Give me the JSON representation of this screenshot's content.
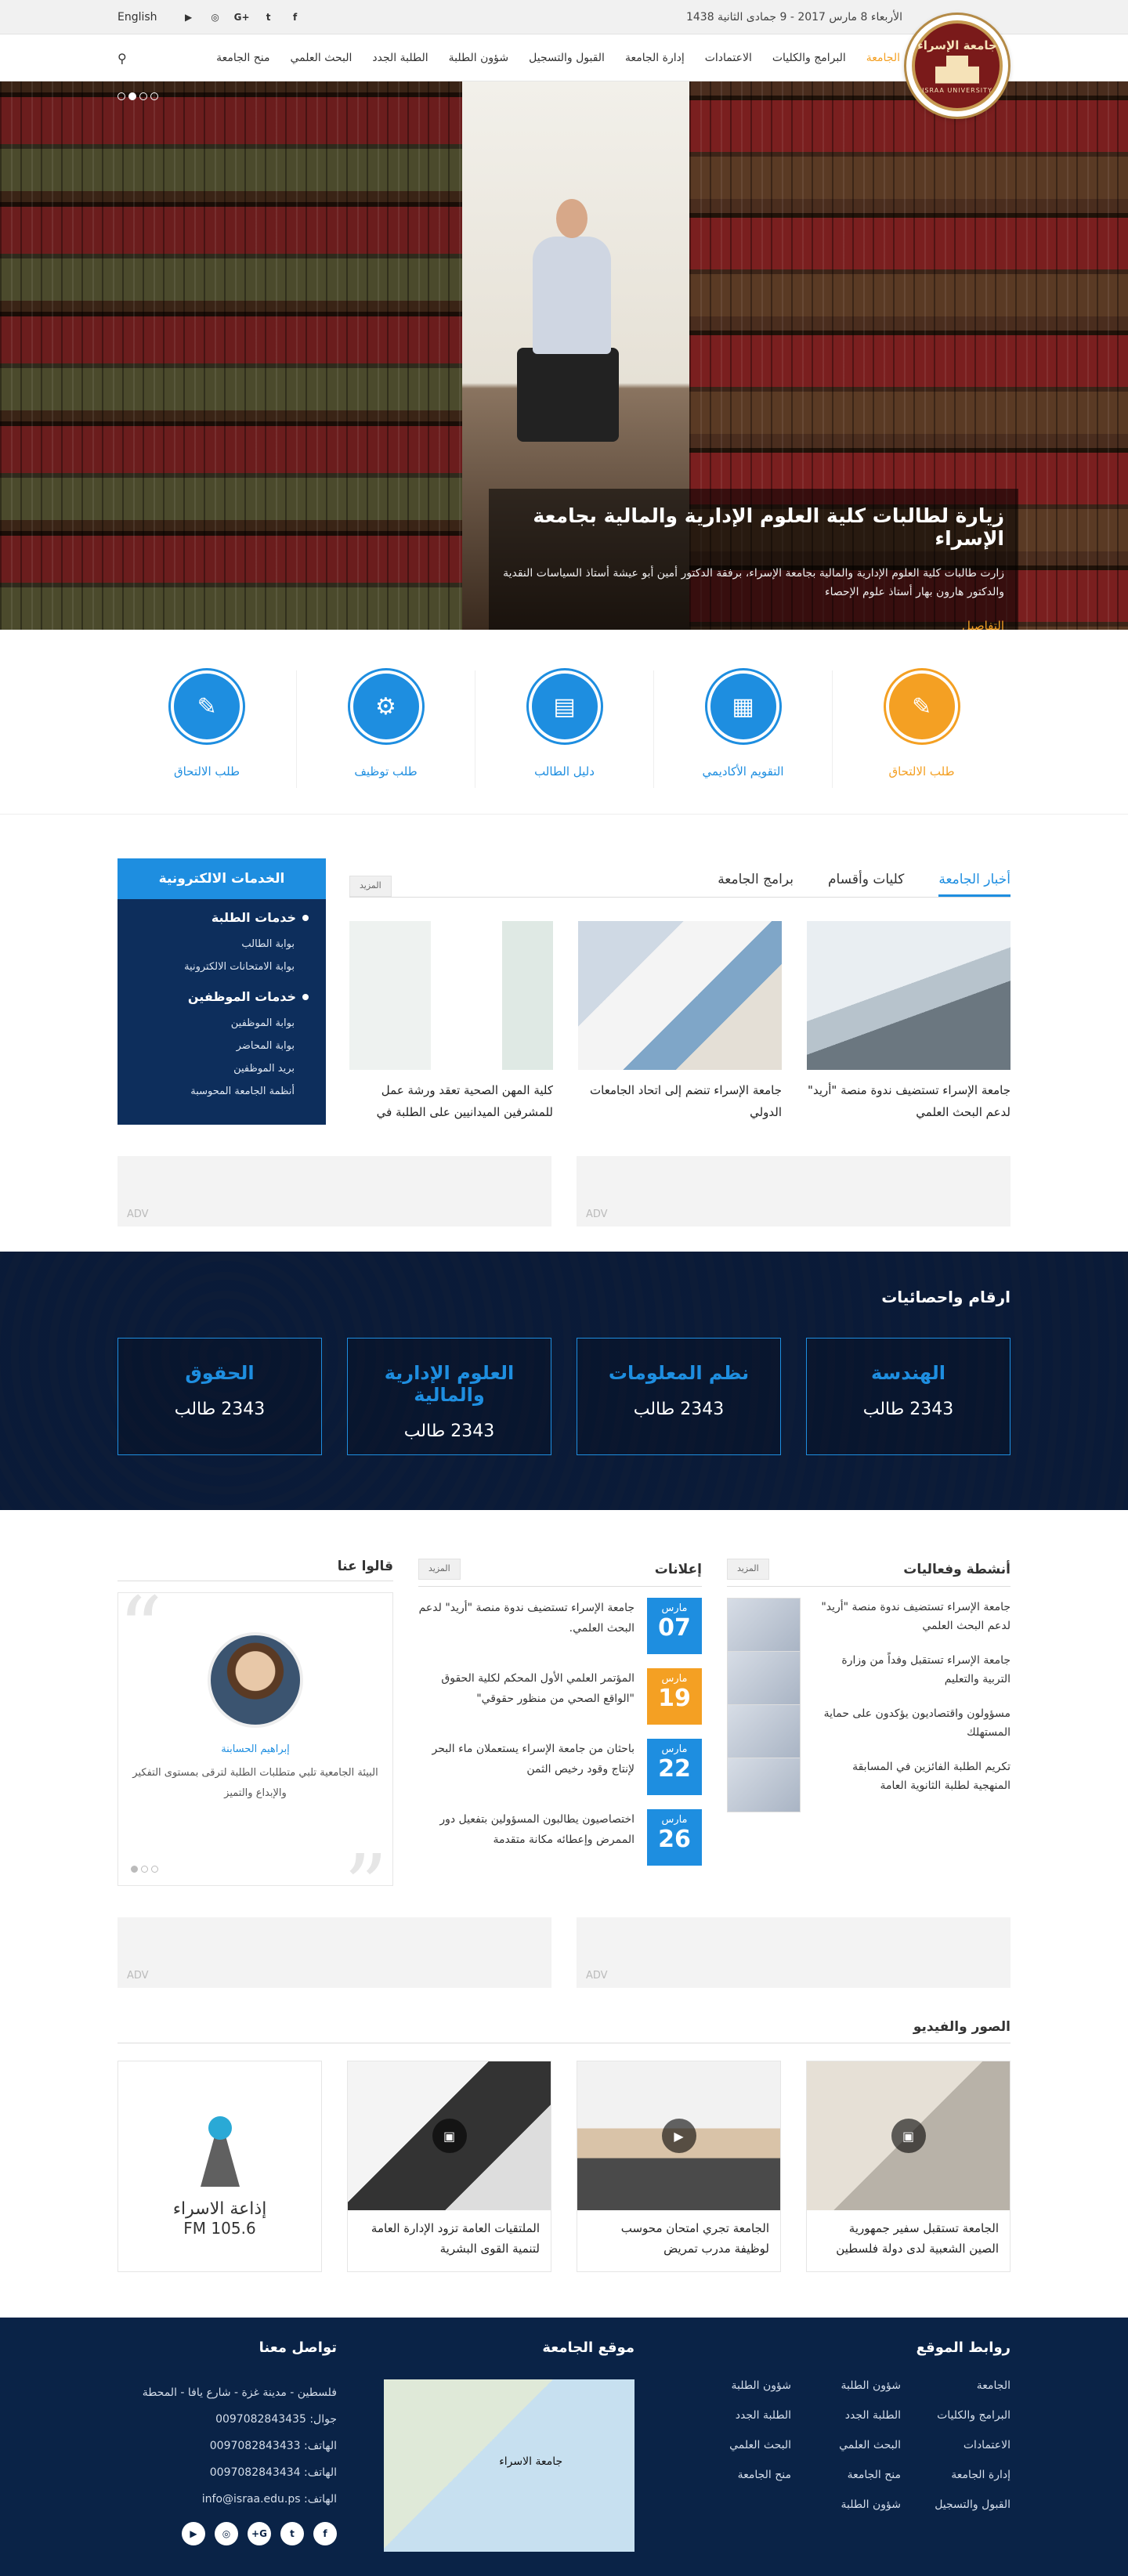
{
  "topbar": {
    "date": "الأربعاء 8 مارس 2017 - 9 جمادى الثانية 1438",
    "language": "English",
    "social": [
      "f",
      "t",
      "G+",
      "◎",
      "▶"
    ]
  },
  "logo": {
    "ar": "جامعة الإسراء",
    "en": "ISRAA UNIVERSITY"
  },
  "nav": {
    "items": [
      "الجامعة",
      "البرامج والكليات",
      "الاعتمادات",
      "إدارة الجامعة",
      "القبول والتسجيل",
      "شؤون الطلبة",
      "الطلبة الجدد",
      "البحث العلمي",
      "منح الجامعة"
    ]
  },
  "hero": {
    "title": "زيارة لطالبات كلية العلوم الإدارية والمالية بجامعة الإسراء",
    "text": "زارت طالبات كلية العلوم الإدارية والمالية بجامعة الإسراء، برفقة الدكتور أمين أبو عيشة أستاذ السياسات النقدية والدكتور هارون بهار أستاذ علوم الإحصاء",
    "link": "التفاصيل"
  },
  "quick": [
    {
      "label": "طلب الالتحاق",
      "icon": "✎"
    },
    {
      "label": "التقويم الأكاديمي",
      "icon": "▦"
    },
    {
      "label": "دليل الطالب",
      "icon": "▤"
    },
    {
      "label": "طلب توظيف",
      "icon": "⚙"
    },
    {
      "label": "طلب الالتحاق",
      "icon": "✎"
    }
  ],
  "eservices": {
    "title": "الخدمات الالكترونية",
    "students": {
      "title": "خدمات الطلبة",
      "items": [
        "بوابة الطالب",
        "بوابة الامتحانات الالكترونية"
      ]
    },
    "staff": {
      "title": "خدمات الموظفين",
      "items": [
        "بوابة الموظفين",
        "بوابة المحاضر",
        "بريد الموظفين",
        "أنظمة الجامعة المحوسبة"
      ]
    }
  },
  "news": {
    "tabs": [
      "أخبار الجامعة",
      "كليات وأقسام",
      "برامج الجامعة"
    ],
    "more": "المزيد",
    "cards": [
      "جامعة الإسراء تستضيف ندوة منصة \"أريد\" لدعم البحث العلمي",
      "جامعة الإسراء تنضم إلى اتحاد الجامعات الدولي",
      "كلية المهن الصحية تعقد ورشة عمل للمشرفين الميدانيين على الطلبة في"
    ]
  },
  "adv": "ADV",
  "stats": {
    "title": "ارقام واحصائيات",
    "items": [
      {
        "name": "الهندسة",
        "value": "2343 طالب"
      },
      {
        "name": "نظم المعلومات",
        "value": "2343 طالب"
      },
      {
        "name": "العلوم الإدارية والمالية",
        "value": "2343 طالب"
      },
      {
        "name": "الحقوق",
        "value": "2343 طالب"
      }
    ]
  },
  "activities": {
    "title": "أنشطة وفعاليات",
    "more": "المزيد",
    "items": [
      "جامعة الإسراء تستضيف ندوة منصة \"أريد\" لدعم البحث العلمي",
      "جامعة الإسراء تستقبل وفداً من وزارة التربية والتعليم",
      "مسؤولون واقتصاديون يؤكدون على حماية المستهلك",
      "تكريم الطلبة الفائزين في المسابقة المنهجية لطلبة الثانوية العامة"
    ]
  },
  "announcements": {
    "title": "إعلانات",
    "more": "المزيد",
    "items": [
      {
        "month": "مارس",
        "day": "07",
        "text": "جامعة الإسراء تستضيف ندوة منصة \"أريد\" لدعم البحث العلمي."
      },
      {
        "month": "مارس",
        "day": "19",
        "text": "المؤتمر العلمي الأول المحكم لكلية الحقوق \"الواقع الصحي من منظور حقوقي\""
      },
      {
        "month": "مارس",
        "day": "22",
        "text": "باحثان من جامعة الإسراء يستعملان ماء البحر لإنتاج وقود رخيص الثمن"
      },
      {
        "month": "مارس",
        "day": "26",
        "text": "اختصاصيون يطالبون المسؤولين بتفعيل دور الممرض وإعطائه مكانة متقدمة"
      }
    ]
  },
  "testimonials": {
    "title": "قالوا عنا",
    "name": "إبراهيم الحسابنة",
    "text": "البيئة الجامعية تلبي متطلبات الطلبة لترقى بمستوى التفكير والإبداع والتميز"
  },
  "media": {
    "title": "الصور والفيديو",
    "items": [
      "الجامعة تستقبل سفير جمهورية الصين الشعبية لدى دولة فلسطين",
      "الجامعة تجري امتحان محوسب لوظيفة مدرب تمريض",
      "الملتقيات العامة تزود الإدارة العامة لتنمية القوى البشرية"
    ],
    "radio": {
      "name": "إذاعة الاسراء",
      "fm": "105.6 FM"
    }
  },
  "footer": {
    "links_title": "روابط الموقع",
    "links": [
      "الجامعة",
      "شؤون الطلبة",
      "شؤون الطلبة",
      "البرامج والكليات",
      "الطلبة الجدد",
      "الطلبة الجدد",
      "الاعتمادات",
      "البحث العلمي",
      "البحث العلمي",
      "إدارة الجامعة",
      "منح الجامعة",
      "منح الجامعة",
      "القبول والتسجيل",
      "شؤون الطلبة"
    ],
    "map_title": "موقع الجامعة",
    "map_pin": "جامعة الاسراء",
    "contact_title": "تواصل معنا",
    "contact": [
      "فلسطين - مدينة غزة - شارع يافا - المحطة",
      "جوال: 0097082843435",
      "الهاتف: 0097082843433",
      "الهاتف: 0097082843434",
      "الهاتف: info@israa.edu.ps"
    ],
    "social": [
      "f",
      "t",
      "G+",
      "◎",
      "▶"
    ]
  }
}
